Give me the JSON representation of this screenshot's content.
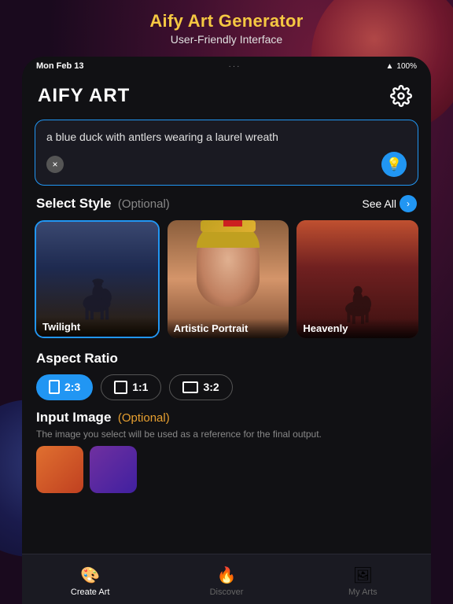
{
  "marketing": {
    "title": "Aify Art Generator",
    "subtitle": "User-Friendly Interface"
  },
  "statusBar": {
    "time": "Mon Feb 13",
    "dots": "···",
    "battery": "100%"
  },
  "header": {
    "appTitle": "AIFY ART"
  },
  "prompt": {
    "text": "a blue duck with antlers wearing a laurel wreath",
    "clearLabel": "×",
    "lightbulbIcon": "💡"
  },
  "styleSection": {
    "title": "Select Style",
    "optional": "(Optional)",
    "seeAll": "See All",
    "cards": [
      {
        "label": "Twilight",
        "selected": true
      },
      {
        "label": "Artistic Portrait",
        "selected": false
      },
      {
        "label": "Heavenly",
        "selected": false
      }
    ]
  },
  "aspectRatio": {
    "title": "Aspect Ratio",
    "options": [
      {
        "label": "2:3",
        "active": true,
        "iconType": "portrait"
      },
      {
        "label": "1:1",
        "active": false,
        "iconType": "square"
      },
      {
        "label": "3:2",
        "active": false,
        "iconType": "landscape"
      }
    ]
  },
  "inputImage": {
    "title": "Input Image",
    "optional": "(Optional)",
    "description": "The image you select will be used as a reference for the final output."
  },
  "bottomNav": {
    "items": [
      {
        "label": "Create Art",
        "icon": "🎨",
        "active": true
      },
      {
        "label": "Discover",
        "icon": "🔥",
        "active": false
      },
      {
        "label": "My Arts",
        "icon": "🖼",
        "active": false
      }
    ]
  }
}
